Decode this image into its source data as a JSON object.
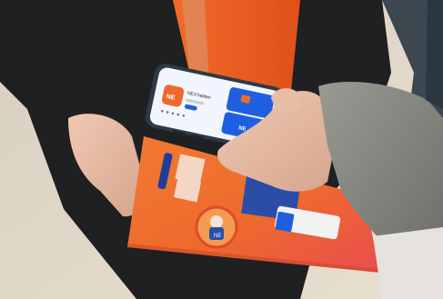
{
  "scene": {
    "description_text": "",
    "palette": {
      "background_warm": "#e9e0d2",
      "jacket_dark": "#1f2022",
      "vest_orange": "#ee5a1f",
      "booklet_orange": "#ee6a2c",
      "booklet_pink": "#ee4b54",
      "phone_body": "#2c3a46",
      "screen_light": "#f2f5fb",
      "app_blue": "#1e5fe0",
      "sleeve_grey": "#8c8c86",
      "skin": "#e4b9a2"
    }
  },
  "phone_screen": {
    "app_icon_text": "NE",
    "app_title": "NE3 helden",
    "install_button": "",
    "banner_text": "NE"
  },
  "booklet": {
    "mascot_badge": "NE"
  }
}
